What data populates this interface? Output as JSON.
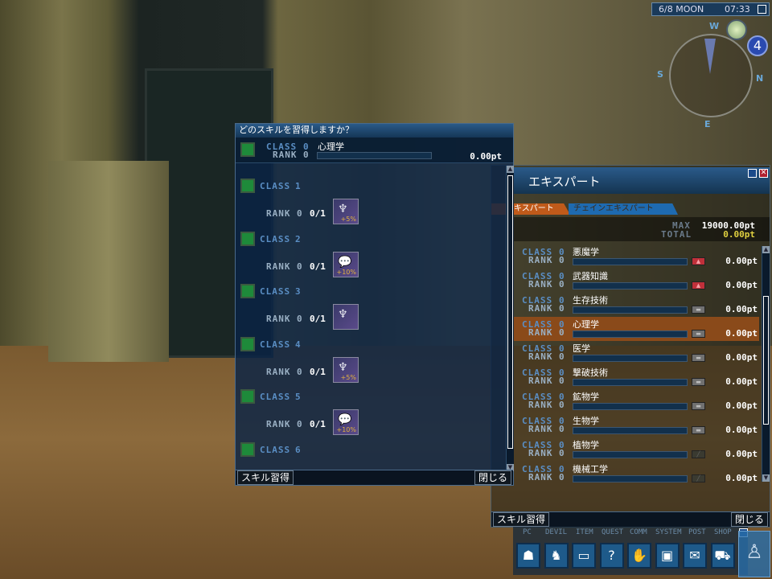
{
  "hud": {
    "date": "6/8 MOON",
    "time": "07:33",
    "compass": {
      "w": "W",
      "s": "S",
      "n": "N",
      "e": "E"
    },
    "moon_phase_badge": "4"
  },
  "skill_dialog": {
    "title": "どのスキルを習得しますか？",
    "header": {
      "class_label": "CLASS",
      "class_value": "0",
      "rank_label": "RANK",
      "rank_value": "0",
      "skill_name": "心理学",
      "points": "0.00pt",
      "progress": 0
    },
    "classes": [
      {
        "label": "CLASS",
        "num": "1",
        "rank_label": "RANK",
        "rank": "0",
        "count": "0/1",
        "icon": "armor-up-icon",
        "icon_text": "+5%"
      },
      {
        "label": "CLASS",
        "num": "2",
        "rank_label": "RANK",
        "rank": "0",
        "count": "0/1",
        "icon": "chat-icon",
        "icon_text": "+10%"
      },
      {
        "label": "CLASS",
        "num": "3",
        "rank_label": "RANK",
        "rank": "0",
        "count": "0/1",
        "icon": "armor-icon",
        "icon_text": ""
      },
      {
        "label": "CLASS",
        "num": "4",
        "rank_label": "RANK",
        "rank": "0",
        "count": "0/1",
        "icon": "armor-up-icon",
        "icon_text": "+5%"
      },
      {
        "label": "CLASS",
        "num": "5",
        "rank_label": "RANK",
        "rank": "0",
        "count": "0/1",
        "icon": "chat-icon",
        "icon_text": "+10%"
      },
      {
        "label": "CLASS",
        "num": "6"
      }
    ],
    "learn_button": "スキル習得",
    "close_button": "閉じる"
  },
  "expert_panel": {
    "title": "エキスパート",
    "tabs": [
      {
        "label": "エキスパート",
        "active": true
      },
      {
        "label": "チェインエキスパート",
        "active": false
      }
    ],
    "max_label": "MAX",
    "max_value": "19000.00pt",
    "total_label": "TOTAL",
    "total_value": "0.00pt",
    "rows": [
      {
        "name": "悪魔学",
        "class": "0",
        "rank": "0",
        "points": "0.00pt",
        "indicator": "up"
      },
      {
        "name": "武器知識",
        "class": "0",
        "rank": "0",
        "points": "0.00pt",
        "indicator": "up"
      },
      {
        "name": "生存技術",
        "class": "0",
        "rank": "0",
        "points": "0.00pt",
        "indicator": "keep"
      },
      {
        "name": "心理学",
        "class": "0",
        "rank": "0",
        "points": "0.00pt",
        "indicator": "keep",
        "selected": true
      },
      {
        "name": "医学",
        "class": "0",
        "rank": "0",
        "points": "0.00pt",
        "indicator": "keep"
      },
      {
        "name": "撃破技術",
        "class": "0",
        "rank": "0",
        "points": "0.00pt",
        "indicator": "keep"
      },
      {
        "name": "鉱物学",
        "class": "0",
        "rank": "0",
        "points": "0.00pt",
        "indicator": "keep"
      },
      {
        "name": "生物学",
        "class": "0",
        "rank": "0",
        "points": "0.00pt",
        "indicator": "keep"
      },
      {
        "name": "植物学",
        "class": "0",
        "rank": "0",
        "points": "0.00pt",
        "indicator": "lock"
      },
      {
        "name": "機械工学",
        "class": "0",
        "rank": "0",
        "points": "0.00pt",
        "indicator": "lock"
      }
    ],
    "class_label": "CLASS",
    "rank_label": "RANK",
    "learn_button": "スキル習得",
    "close_button": "閉じる"
  },
  "menu": {
    "tabs": [
      "PC",
      "DEVIL",
      "ITEM",
      "QUEST",
      "COMM",
      "SYSTEM",
      "POST",
      "SHOP"
    ],
    "buttons": [
      {
        "icon": "person-icon",
        "glyph": "☗"
      },
      {
        "icon": "devil-icon",
        "glyph": "♞"
      },
      {
        "icon": "item-box-icon",
        "glyph": "▭"
      },
      {
        "icon": "quest-icon",
        "glyph": "?"
      },
      {
        "icon": "handshake-icon",
        "glyph": "✋"
      },
      {
        "icon": "computer-icon",
        "glyph": "▣"
      },
      {
        "icon": "post-icon",
        "glyph": "✉"
      },
      {
        "icon": "cart-icon",
        "glyph": "⛟"
      }
    ]
  },
  "colors": {
    "accent": "#5a8ec4",
    "selected_row": "#8a4a1a",
    "tab_active": "#c05a1a",
    "tab_inactive": "#1e6ab0",
    "total": "#e0d040",
    "indicator_up": "#c0303a"
  }
}
